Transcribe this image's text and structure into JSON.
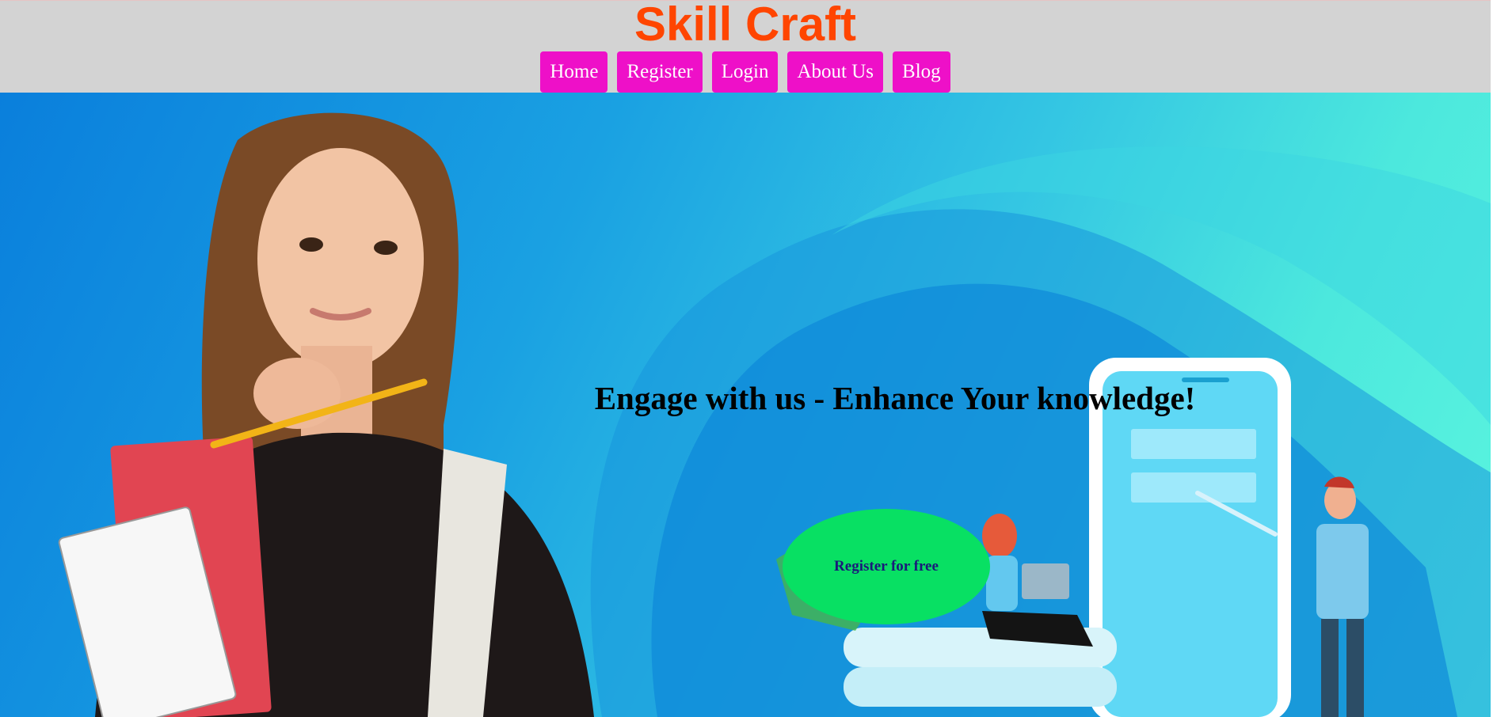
{
  "site": {
    "title": "Skill Craft"
  },
  "nav": {
    "items": [
      {
        "label": "Home"
      },
      {
        "label": "Register"
      },
      {
        "label": "Login"
      },
      {
        "label": "About Us"
      },
      {
        "label": "Blog"
      }
    ]
  },
  "hero": {
    "headline": "Engage with us - Enhance Your knowledge!",
    "cta_label": "Register for free",
    "images": [
      "student-with-notebooks",
      "phone-learning-illustration"
    ]
  },
  "colors": {
    "header_bg": "#d3d3d3",
    "title": "#ff4500",
    "nav_button": "#ee10c8",
    "nav_text": "#ffffff",
    "cta_bg": "#08e063",
    "cta_text": "#1a1a7a",
    "hero_gradient_start": "#0a7fdc",
    "hero_gradient_end": "#5cf6df"
  }
}
